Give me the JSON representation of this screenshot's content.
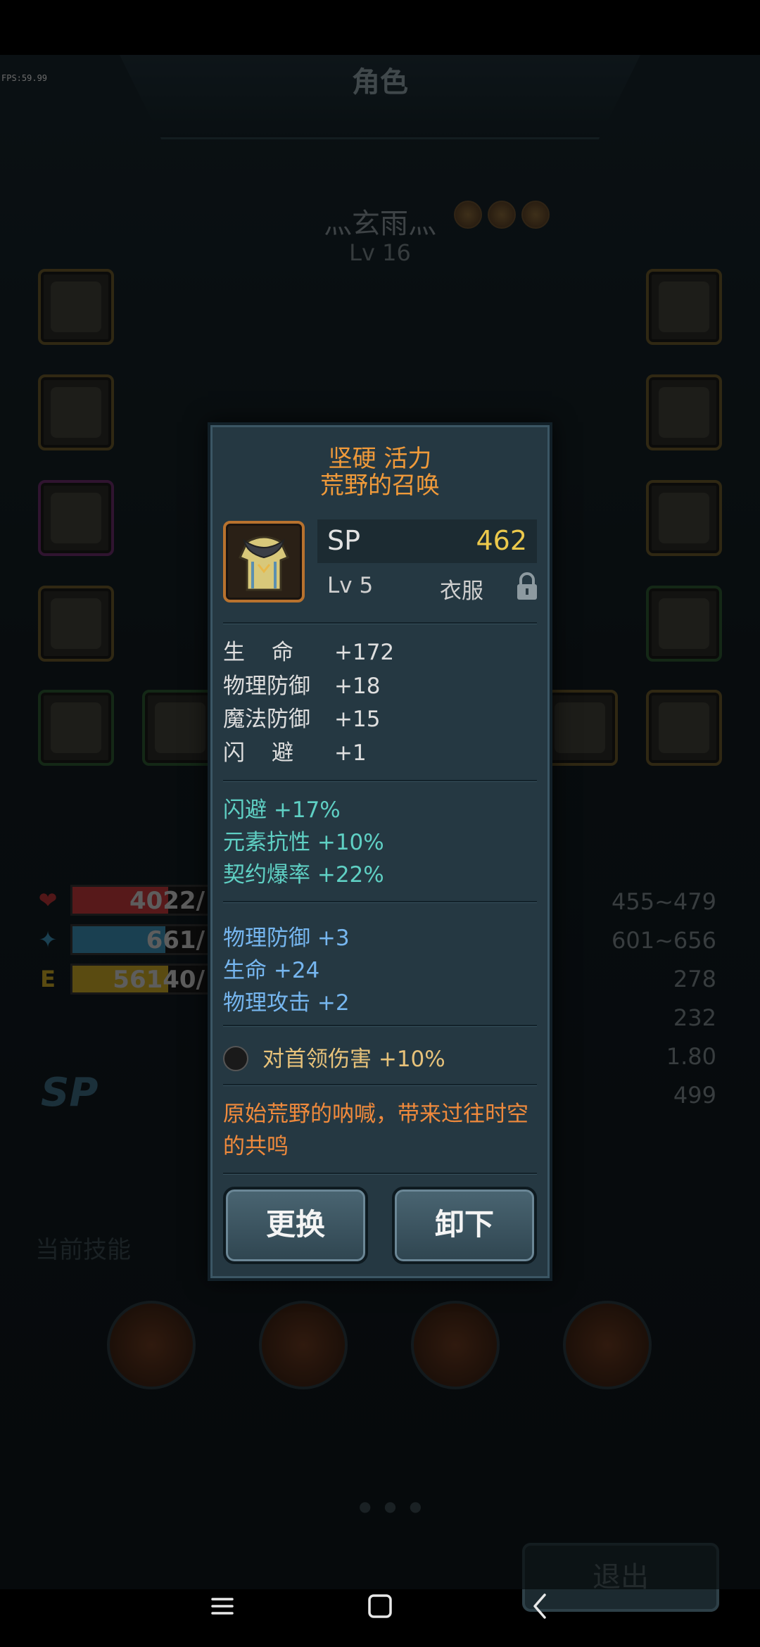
{
  "fps": "FPS:59.99",
  "header": {
    "title": "角色"
  },
  "character": {
    "name": "灬玄雨灬",
    "level": "Lv 16"
  },
  "bars": [
    {
      "icon": "heart-icon",
      "symbol": "❤",
      "value": "4022/",
      "color": "#c0393b",
      "fill": 0.7
    },
    {
      "icon": "mana-icon",
      "symbol": "✦",
      "value": "661/",
      "color": "#3b8fb3",
      "fill": 0.68
    },
    {
      "icon": "exp-icon",
      "symbol": "E",
      "value": "56140/",
      "color": "#c7a626",
      "fill": 0.7
    }
  ],
  "stats_right": [
    "455~479",
    "601~656",
    "278",
    "232",
    "1.80",
    "499"
  ],
  "sp_label": "SP",
  "skills_title": "当前技能",
  "pager": "● ● ●",
  "exit_label": "退出",
  "popup": {
    "title_line1": "坚硬 活力",
    "title_line2": "荒野的召唤",
    "sp_label": "SP",
    "sp_value": "462",
    "level": "Lv 5",
    "type": "衣服",
    "base_stats": [
      {
        "name": "生命",
        "value": "+172"
      },
      {
        "name": "物理防御",
        "value": "+18"
      },
      {
        "name": "魔法防御",
        "value": "+15"
      },
      {
        "name": "闪避",
        "value": "+1"
      }
    ],
    "bonus_cyan": [
      "闪避 +17%",
      "元素抗性 +10%",
      "契约爆率 +22%"
    ],
    "bonus_blue": [
      "物理防御 +3",
      "生命 +24",
      "物理攻击 +2"
    ],
    "set_bonus": "对首领伤害 +10%",
    "description": "原始荒野的呐喊，带来过往时空的共鸣",
    "buttons": {
      "replace": "更换",
      "unequip": "卸下"
    }
  },
  "colors": {
    "title_orange": "#f09a3a",
    "sp_yellow": "#ecc94c",
    "cyan": "#5fd0c4",
    "blue": "#76b6ef",
    "desc_orange": "#f08a3c"
  }
}
